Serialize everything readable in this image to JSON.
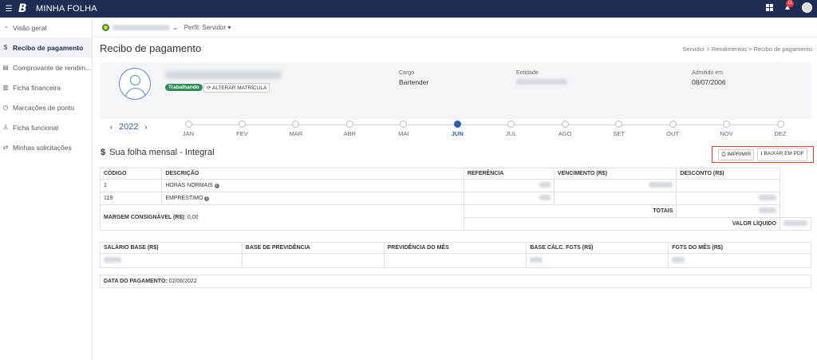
{
  "app": {
    "title": "MINHA FOLHA",
    "logo_letter": "B",
    "notif_count": "11"
  },
  "sidebar": {
    "items": [
      {
        "icon": "◔",
        "label": "Visão geral"
      },
      {
        "icon": "$",
        "label": "Recibo de pagamento"
      },
      {
        "icon": "▤",
        "label": "Comprovante de rendim..."
      },
      {
        "icon": "▥",
        "label": "Ficha financeira"
      },
      {
        "icon": "◷",
        "label": "Marcações de ponto"
      },
      {
        "icon": "♙",
        "label": "Ficha funcional"
      },
      {
        "icon": "⇄",
        "label": "Minhas solicitações"
      }
    ]
  },
  "profile": {
    "label": "Perfil: Servidor ▾"
  },
  "page": {
    "title": "Recibo de pagamento",
    "breadcrumb": "Servidor > Rendimentos > Recibo de pagamento"
  },
  "employee": {
    "status": "Trabalhando",
    "change_btn": "⟳ ALTERAR MATRÍCULA",
    "cargo_label": "Cargo",
    "cargo_value": "Bartender",
    "entidade_label": "Entidade",
    "admitido_label": "Admitido em",
    "admitido_value": "08/07/2006"
  },
  "timeline": {
    "year": "2022",
    "prev": "‹",
    "next": "›",
    "months": [
      "JAN",
      "FEV",
      "MAR",
      "ABR",
      "MAI",
      "JUN",
      "JUL",
      "AGO",
      "SET",
      "OUT",
      "NOV",
      "DEZ"
    ],
    "active_month": "JUN"
  },
  "folha": {
    "icon": "$",
    "title": "Sua folha mensal - Integral",
    "print_btn": "IMPRIMIR",
    "pdf_btn": "BAIXAR EM PDF"
  },
  "table": {
    "headers": [
      "CÓDIGO",
      "DESCRIÇÃO",
      "REFERÊNCIA",
      "VENCIMENTO (R$)",
      "DESCONTO (R$)"
    ],
    "rows": [
      {
        "code": "1",
        "desc": "HORAS NORMAIS"
      },
      {
        "code": "119",
        "desc": "EMPRÉSTIMO"
      }
    ],
    "margem_label": "MARGEM CONSIGNÁVEL (R$):",
    "margem_value": "0,00",
    "totais_label": "TOTAIS",
    "liquido_label": "VALOR LÍQUIDO"
  },
  "summary": {
    "headers": [
      "SALÁRIO BASE (R$)",
      "BASE DE PREVIDÊNCIA",
      "PREVIDÊNCIA DO MÊS",
      "BASE CÁLC. FGTS (R$)",
      "FGTS DO MÊS (R$)"
    ]
  },
  "payment": {
    "label": "DATA DO PAGAMENTO:",
    "value": "02/06/2022"
  },
  "colors": {
    "navy": "#1f2c54",
    "accent": "#2f5da8",
    "status_green": "#2e8b57",
    "highlight_red": "#e53935"
  }
}
